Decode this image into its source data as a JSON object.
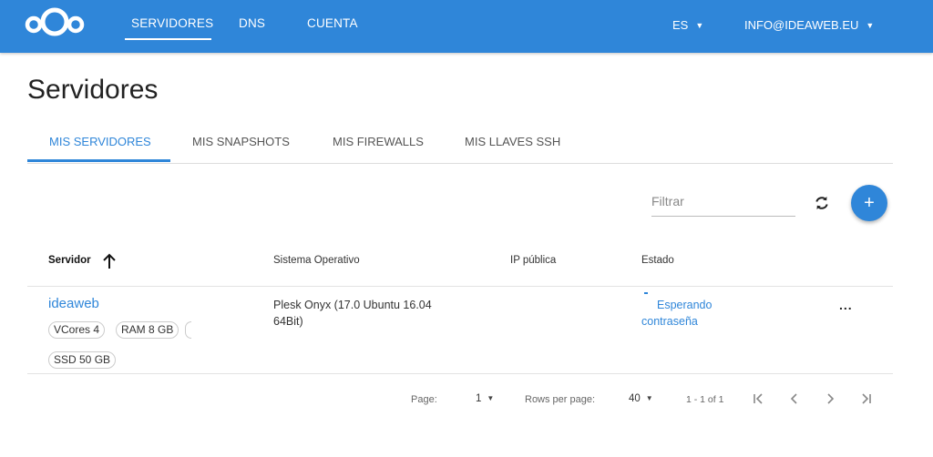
{
  "nav": {
    "items": [
      "SERVIDORES",
      "DNS",
      "CUENTA"
    ],
    "language": "ES",
    "account": "INFO@IDEAWEB.EU"
  },
  "page": {
    "title": "Servidores"
  },
  "tabs": [
    "MIS SERVIDORES",
    "MIS SNAPSHOTS",
    "MIS FIREWALLS",
    "MIS LLAVES SSH"
  ],
  "toolbar": {
    "filter_placeholder": "Filtrar",
    "add_label": "+"
  },
  "table": {
    "headers": [
      "Servidor",
      "Sistema Operativo",
      "IP pública",
      "Estado"
    ],
    "rows": [
      {
        "name": "ideaweb",
        "tags": [
          "VCores 4",
          "RAM 8 GB",
          "SSD 50 GB"
        ],
        "os": "Plesk Onyx (17.0 Ubuntu 16.04 64Bit)",
        "ip": "",
        "status": "Esperando contraseña",
        "actions_label": "..."
      }
    ]
  },
  "pagination": {
    "page_label": "Page:",
    "page_value": "1",
    "rows_label": "Rows per page:",
    "rows_value": "40",
    "range": "1 - 1 of 1"
  },
  "colors": {
    "primary": "#2f86d9",
    "divider": "#e3e3e3"
  }
}
